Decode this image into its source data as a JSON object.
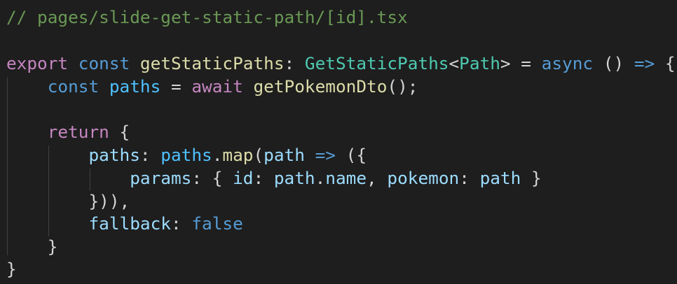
{
  "code": {
    "lines": [
      [
        {
          "t": "// pages/slide-get-static-path/[id].tsx",
          "c": "c-comment"
        }
      ],
      [],
      [
        {
          "t": "export",
          "c": "c-kw"
        },
        {
          "t": " ",
          "c": "c-punct"
        },
        {
          "t": "const",
          "c": "c-storage"
        },
        {
          "t": " ",
          "c": "c-punct"
        },
        {
          "t": "getStaticPaths",
          "c": "c-fn"
        },
        {
          "t": ": ",
          "c": "c-punct"
        },
        {
          "t": "GetStaticPaths",
          "c": "c-type"
        },
        {
          "t": "<",
          "c": "c-punct"
        },
        {
          "t": "Path",
          "c": "c-type"
        },
        {
          "t": "> = ",
          "c": "c-punct"
        },
        {
          "t": "async",
          "c": "c-storage"
        },
        {
          "t": " () ",
          "c": "c-punct"
        },
        {
          "t": "=>",
          "c": "c-storage"
        },
        {
          "t": " {",
          "c": "c-punct"
        }
      ],
      [
        {
          "t": "    ",
          "c": "c-punct"
        },
        {
          "t": "const",
          "c": "c-storage"
        },
        {
          "t": " ",
          "c": "c-punct"
        },
        {
          "t": "paths",
          "c": "c-const"
        },
        {
          "t": " = ",
          "c": "c-punct"
        },
        {
          "t": "await",
          "c": "c-kw"
        },
        {
          "t": " ",
          "c": "c-punct"
        },
        {
          "t": "getPokemonDto",
          "c": "c-fn"
        },
        {
          "t": "();",
          "c": "c-punct"
        }
      ],
      [],
      [
        {
          "t": "    ",
          "c": "c-punct"
        },
        {
          "t": "return",
          "c": "c-kw"
        },
        {
          "t": " {",
          "c": "c-punct"
        }
      ],
      [
        {
          "t": "        ",
          "c": "c-punct"
        },
        {
          "t": "paths",
          "c": "c-var"
        },
        {
          "t": ": ",
          "c": "c-punct"
        },
        {
          "t": "paths",
          "c": "c-const"
        },
        {
          "t": ".",
          "c": "c-punct"
        },
        {
          "t": "map",
          "c": "c-fn"
        },
        {
          "t": "(",
          "c": "c-punct"
        },
        {
          "t": "path",
          "c": "c-var"
        },
        {
          "t": " ",
          "c": "c-punct"
        },
        {
          "t": "=>",
          "c": "c-storage"
        },
        {
          "t": " ({",
          "c": "c-punct"
        }
      ],
      [
        {
          "t": "            ",
          "c": "c-punct"
        },
        {
          "t": "params",
          "c": "c-var"
        },
        {
          "t": ": { ",
          "c": "c-punct"
        },
        {
          "t": "id",
          "c": "c-var"
        },
        {
          "t": ": ",
          "c": "c-punct"
        },
        {
          "t": "path",
          "c": "c-var"
        },
        {
          "t": ".",
          "c": "c-punct"
        },
        {
          "t": "name",
          "c": "c-var"
        },
        {
          "t": ", ",
          "c": "c-punct"
        },
        {
          "t": "pokemon",
          "c": "c-var"
        },
        {
          "t": ": ",
          "c": "c-punct"
        },
        {
          "t": "path",
          "c": "c-var"
        },
        {
          "t": " }",
          "c": "c-punct"
        }
      ],
      [
        {
          "t": "        ",
          "c": "c-punct"
        },
        {
          "t": "})),",
          "c": "c-punct"
        }
      ],
      [
        {
          "t": "        ",
          "c": "c-punct"
        },
        {
          "t": "fallback",
          "c": "c-var"
        },
        {
          "t": ": ",
          "c": "c-punct"
        },
        {
          "t": "false",
          "c": "c-bool"
        }
      ],
      [
        {
          "t": "    ",
          "c": "c-punct"
        },
        {
          "t": "}",
          "c": "c-punct"
        }
      ],
      [
        {
          "t": "}",
          "c": "c-punct"
        }
      ]
    ]
  },
  "theme": {
    "background": "#1e1e1e",
    "indent_guide": "#404040"
  }
}
